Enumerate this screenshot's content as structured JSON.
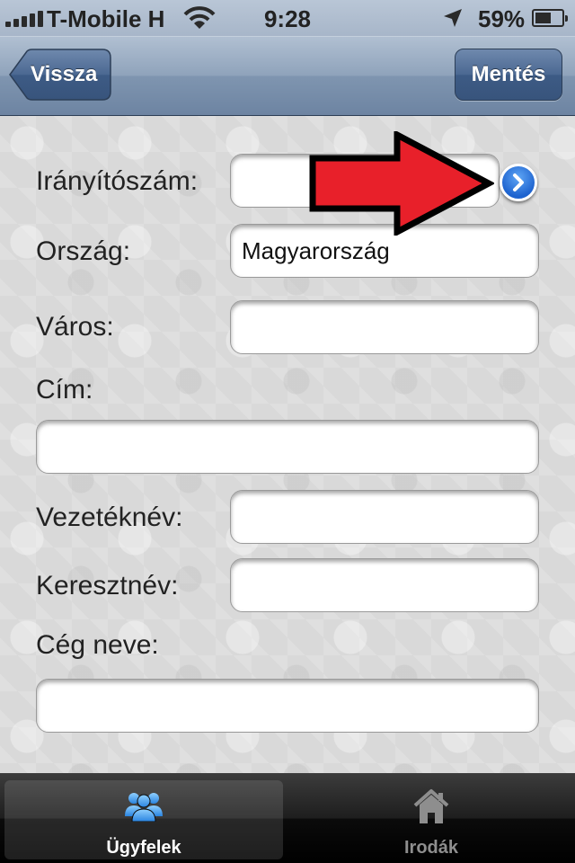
{
  "status_bar": {
    "carrier": "T-Mobile H",
    "time": "9:28",
    "battery_percent": "59%",
    "battery_level": 0.59
  },
  "nav": {
    "back_label": "Vissza",
    "save_label": "Mentés"
  },
  "form": {
    "fields": [
      {
        "label": "Irányítószám:",
        "value": ""
      },
      {
        "label": "Ország:",
        "value": "Magyarország"
      },
      {
        "label": "Város:",
        "value": ""
      },
      {
        "label": "Cím:",
        "value": ""
      },
      {
        "label": "Vezetéknév:",
        "value": ""
      },
      {
        "label": "Keresztnév:",
        "value": ""
      },
      {
        "label": "Cég neve:",
        "value": ""
      }
    ]
  },
  "tabs": [
    {
      "label": "Ügyfelek",
      "icon": "people-icon",
      "active": true
    },
    {
      "label": "Irodák",
      "icon": "house-icon",
      "active": false
    }
  ],
  "colors": {
    "nav_bar": "#8fa3bb",
    "go_button": "#1e63cf",
    "annotation_arrow": "#e8202a"
  }
}
